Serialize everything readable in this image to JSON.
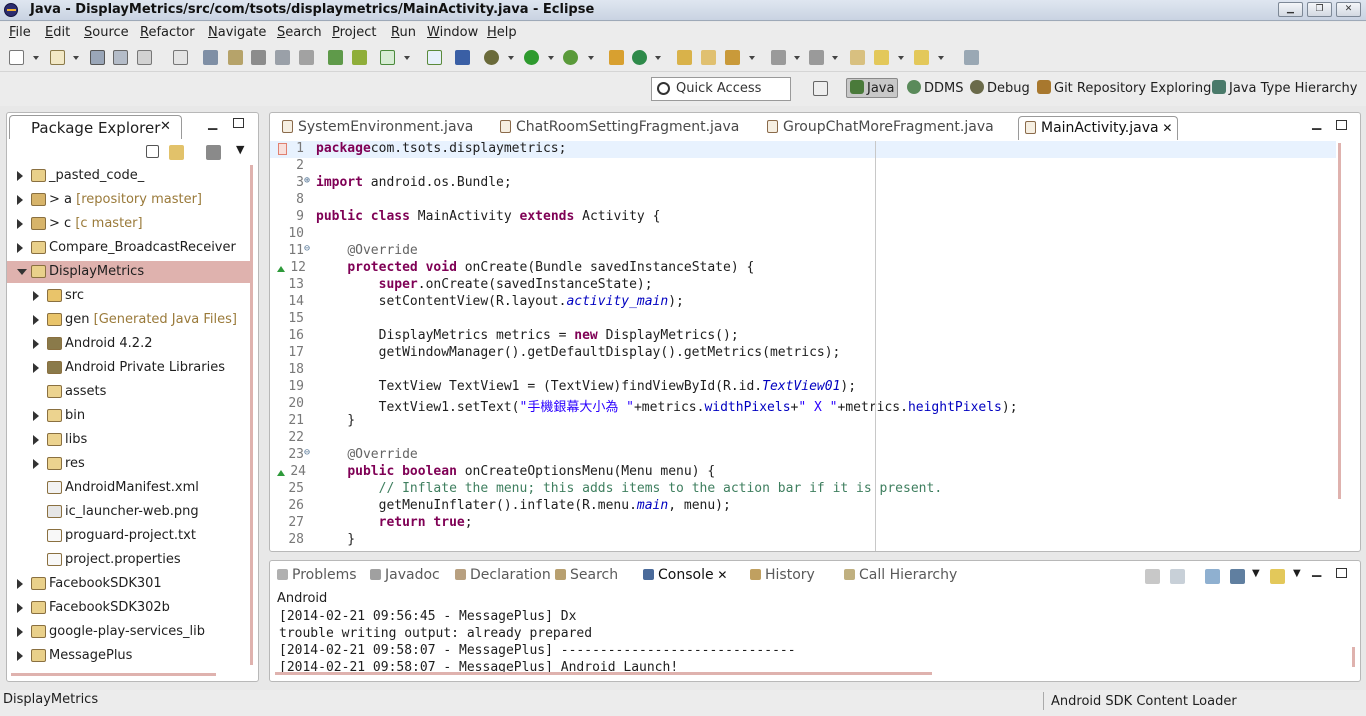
{
  "window": {
    "title": "Java - DisplayMetrics/src/com/tsots/displaymetrics/MainActivity.java - Eclipse"
  },
  "menu": [
    "File",
    "Edit",
    "Source",
    "Refactor",
    "Navigate",
    "Search",
    "Project",
    "Run",
    "Window",
    "Help"
  ],
  "quick_access": {
    "placeholder": "Quick Access"
  },
  "perspectives": [
    "Java",
    "DDMS",
    "Debug",
    "Git Repository Exploring",
    "Java Type Hierarchy"
  ],
  "package_explorer": {
    "title": "Package Explorer",
    "items": [
      {
        "label": "_pasted_code_",
        "decoration": "",
        "indent": 0,
        "expanded": false,
        "has_children": true,
        "selected": false,
        "icon": "project-folder-icon"
      },
      {
        "label": "> a",
        "decoration": "[repository master]",
        "indent": 0,
        "expanded": false,
        "has_children": true,
        "selected": false,
        "icon": "git-project-icon"
      },
      {
        "label": "> c",
        "decoration": "[c master]",
        "indent": 0,
        "expanded": false,
        "has_children": true,
        "selected": false,
        "icon": "git-project-icon"
      },
      {
        "label": "Compare_BroadcastReceiver",
        "decoration": "",
        "indent": 0,
        "expanded": false,
        "has_children": true,
        "selected": false,
        "icon": "project-folder-icon"
      },
      {
        "label": "DisplayMetrics",
        "decoration": "",
        "indent": 0,
        "expanded": true,
        "has_children": true,
        "selected": true,
        "icon": "project-folder-icon"
      },
      {
        "label": "src",
        "decoration": "",
        "indent": 1,
        "expanded": false,
        "has_children": true,
        "selected": false,
        "icon": "source-folder-icon"
      },
      {
        "label": "gen",
        "decoration": "[Generated Java Files]",
        "indent": 1,
        "expanded": false,
        "has_children": true,
        "selected": false,
        "icon": "source-folder-icon"
      },
      {
        "label": "Android 4.2.2",
        "decoration": "",
        "indent": 1,
        "expanded": false,
        "has_children": true,
        "selected": false,
        "icon": "library-icon"
      },
      {
        "label": "Android Private Libraries",
        "decoration": "",
        "indent": 1,
        "expanded": false,
        "has_children": true,
        "selected": false,
        "icon": "library-icon"
      },
      {
        "label": "assets",
        "decoration": "",
        "indent": 1,
        "expanded": false,
        "has_children": false,
        "selected": false,
        "icon": "folder-icon"
      },
      {
        "label": "bin",
        "decoration": "",
        "indent": 1,
        "expanded": false,
        "has_children": true,
        "selected": false,
        "icon": "folder-icon"
      },
      {
        "label": "libs",
        "decoration": "",
        "indent": 1,
        "expanded": false,
        "has_children": true,
        "selected": false,
        "icon": "folder-icon"
      },
      {
        "label": "res",
        "decoration": "",
        "indent": 1,
        "expanded": false,
        "has_children": true,
        "selected": false,
        "icon": "folder-icon"
      },
      {
        "label": "AndroidManifest.xml",
        "decoration": "",
        "indent": 1,
        "expanded": false,
        "has_children": false,
        "selected": false,
        "icon": "xml-file-icon"
      },
      {
        "label": "ic_launcher-web.png",
        "decoration": "",
        "indent": 1,
        "expanded": false,
        "has_children": false,
        "selected": false,
        "icon": "image-file-icon"
      },
      {
        "label": "proguard-project.txt",
        "decoration": "",
        "indent": 1,
        "expanded": false,
        "has_children": false,
        "selected": false,
        "icon": "text-file-icon"
      },
      {
        "label": "project.properties",
        "decoration": "",
        "indent": 1,
        "expanded": false,
        "has_children": false,
        "selected": false,
        "icon": "text-file-icon"
      },
      {
        "label": "FacebookSDK301",
        "decoration": "",
        "indent": 0,
        "expanded": false,
        "has_children": true,
        "selected": false,
        "icon": "project-folder-icon"
      },
      {
        "label": "FacebookSDK302b",
        "decoration": "",
        "indent": 0,
        "expanded": false,
        "has_children": true,
        "selected": false,
        "icon": "project-folder-icon"
      },
      {
        "label": "google-play-services_lib",
        "decoration": "",
        "indent": 0,
        "expanded": false,
        "has_children": true,
        "selected": false,
        "icon": "project-folder-icon"
      },
      {
        "label": "MessagePlus",
        "decoration": "",
        "indent": 0,
        "expanded": false,
        "has_children": true,
        "selected": false,
        "icon": "project-folder-icon"
      }
    ]
  },
  "editor": {
    "tabs": [
      {
        "label": "SystemEnvironment.java",
        "active": false
      },
      {
        "label": "ChatRoomSettingFragment.java",
        "active": false
      },
      {
        "label": "GroupChatMoreFragment.java",
        "active": false
      },
      {
        "label": "MainActivity.java",
        "active": true
      }
    ],
    "lines": [
      {
        "n": "1",
        "t": [
          [
            "kw",
            "package"
          ],
          [
            "",
            "com.tsots.displaymetrics;"
          ]
        ],
        "current": true
      },
      {
        "n": "2",
        "t": []
      },
      {
        "n": "3",
        "t": [
          [
            "kw",
            "import"
          ],
          [
            "",
            " android.os.Bundle;"
          ]
        ],
        "fold": "+"
      },
      {
        "n": "8",
        "t": []
      },
      {
        "n": "9",
        "t": [
          [
            "kw",
            "public"
          ],
          [
            "",
            ""
          ],
          [
            "kw",
            "class"
          ],
          [
            "",
            " MainActivity "
          ],
          [
            "kw",
            "extends"
          ],
          [
            "",
            " Activity {"
          ]
        ]
      },
      {
        "n": "10",
        "t": []
      },
      {
        "n": "11",
        "t": [
          [
            "",
            "    "
          ],
          [
            "an",
            "@Override"
          ]
        ],
        "fold": "-"
      },
      {
        "n": "12",
        "t": [
          [
            "",
            "    "
          ],
          [
            "kw",
            "protected"
          ],
          [
            "",
            " "
          ],
          [
            "kw",
            "void"
          ],
          [
            "",
            " onCreate(Bundle savedInstanceState) {"
          ]
        ],
        "override": true
      },
      {
        "n": "13",
        "t": [
          [
            "",
            "        "
          ],
          [
            "kw",
            "super"
          ],
          [
            "",
            ".onCreate(savedInstanceState);"
          ]
        ]
      },
      {
        "n": "14",
        "t": [
          [
            "",
            "        setContentView(R.layout."
          ],
          [
            "it",
            "activity_main"
          ],
          [
            "",
            ");"
          ]
        ]
      },
      {
        "n": "15",
        "t": []
      },
      {
        "n": "16",
        "t": [
          [
            "",
            "        DisplayMetrics metrics = "
          ],
          [
            "kw",
            "new"
          ],
          [
            "",
            " DisplayMetrics();"
          ]
        ]
      },
      {
        "n": "17",
        "t": [
          [
            "",
            "        getWindowManager().getDefaultDisplay().getMetrics(metrics);"
          ]
        ]
      },
      {
        "n": "18",
        "t": []
      },
      {
        "n": "19",
        "t": [
          [
            "",
            "        TextView TextView1 = (TextView)findViewById(R.id."
          ],
          [
            "it",
            "TextView01"
          ],
          [
            "",
            ");"
          ]
        ]
      },
      {
        "n": "20",
        "t": [
          [
            "",
            "        TextView1.setText("
          ],
          [
            "st",
            "\"手機銀幕大小為 \""
          ],
          [
            "",
            "+metrics."
          ],
          [
            "fi",
            "widthPixels"
          ],
          [
            "",
            "+"
          ],
          [
            "st",
            "\" X \""
          ],
          [
            "",
            "+metrics."
          ],
          [
            "fi",
            "heightPixels"
          ],
          [
            "",
            ");"
          ]
        ]
      },
      {
        "n": "21",
        "t": [
          [
            "",
            "    }"
          ]
        ]
      },
      {
        "n": "22",
        "t": []
      },
      {
        "n": "23",
        "t": [
          [
            "",
            "    "
          ],
          [
            "an",
            "@Override"
          ]
        ],
        "fold": "-"
      },
      {
        "n": "24",
        "t": [
          [
            "",
            "    "
          ],
          [
            "kw",
            "public"
          ],
          [
            "",
            " "
          ],
          [
            "kw",
            "boolean"
          ],
          [
            "",
            " onCreateOptionsMenu(Menu menu) {"
          ]
        ],
        "override": true
      },
      {
        "n": "25",
        "t": [
          [
            "",
            "        "
          ],
          [
            "cm",
            "// Inflate the menu; this adds items to the action bar if it is present."
          ]
        ]
      },
      {
        "n": "26",
        "t": [
          [
            "",
            "        getMenuInflater().inflate(R.menu."
          ],
          [
            "it",
            "main"
          ],
          [
            "",
            ", menu);"
          ]
        ]
      },
      {
        "n": "27",
        "t": [
          [
            "",
            "        "
          ],
          [
            "kw",
            "return"
          ],
          [
            "",
            " "
          ],
          [
            "kw",
            "true"
          ],
          [
            "",
            ";"
          ]
        ]
      },
      {
        "n": "28",
        "t": [
          [
            "",
            "    }"
          ]
        ]
      }
    ]
  },
  "bottom": {
    "tabs": [
      {
        "label": "Problems",
        "active": false
      },
      {
        "label": "Javadoc",
        "active": false
      },
      {
        "label": "Declaration",
        "active": false
      },
      {
        "label": "Search",
        "active": false
      },
      {
        "label": "Console",
        "active": true
      },
      {
        "label": "History",
        "active": false
      },
      {
        "label": "Call Hierarchy",
        "active": false
      }
    ],
    "console_name": "Android",
    "lines": [
      "[2014-02-21 09:56:45 - MessagePlus] Dx",
      "trouble writing output: already prepared",
      "[2014-02-21 09:58:07 - MessagePlus] ------------------------------",
      "[2014-02-21 09:58:07 - MessagePlus] Android Launch!"
    ]
  },
  "status": {
    "left": "DisplayMetrics",
    "right": "Android SDK Content Loader"
  },
  "colors": {
    "keyword": "#7f0055",
    "string": "#2a00ff",
    "comment": "#3f7f5f",
    "field": "#0000c0",
    "annotation": "#646464",
    "selection": "#dfb2ae",
    "current_line": "#e8f2fe"
  }
}
